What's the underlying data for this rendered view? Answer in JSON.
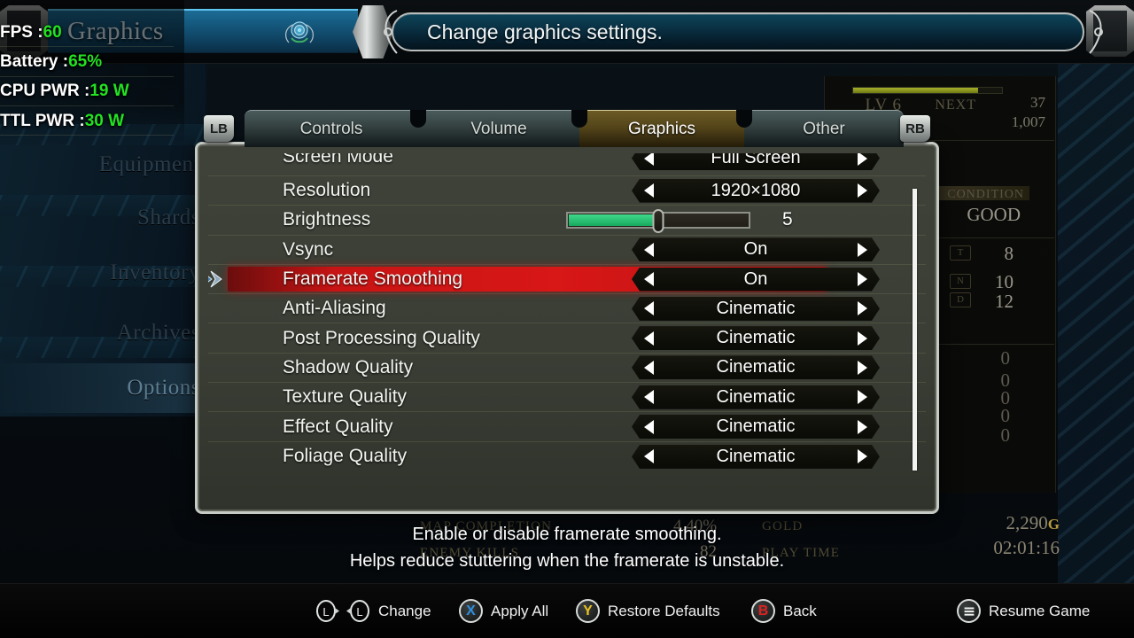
{
  "perf_overlay": {
    "rows": [
      {
        "label": "FPS :",
        "value": "60"
      },
      {
        "label": "Battery :",
        "value": "65%"
      },
      {
        "label": "CPU PWR :",
        "value": "19 W"
      },
      {
        "label": "TTL PWR :",
        "value": "30 W"
      }
    ],
    "value_color": "#22e222"
  },
  "header": {
    "title": "Graphics",
    "tooltip": "Change graphics settings."
  },
  "tabs": {
    "shoulder_left": "LB",
    "shoulder_right": "RB",
    "items": [
      {
        "label": "Controls",
        "active": false
      },
      {
        "label": "Volume",
        "active": false
      },
      {
        "label": "Graphics",
        "active": true
      },
      {
        "label": "Other",
        "active": false
      }
    ]
  },
  "settings": [
    {
      "name": "Screen Mode",
      "value": "Full Screen",
      "type": "stepper",
      "clipped": true,
      "selected": false
    },
    {
      "name": "Resolution",
      "value": "1920×1080",
      "type": "stepper",
      "selected": false
    },
    {
      "name": "Brightness",
      "value": "5",
      "type": "slider",
      "fill_percent": 50,
      "selected": false
    },
    {
      "name": "Vsync",
      "value": "On",
      "type": "stepper",
      "selected": false
    },
    {
      "name": "Framerate Smoothing",
      "value": "On",
      "type": "stepper",
      "selected": true
    },
    {
      "name": "Anti-Aliasing",
      "value": "Cinematic",
      "type": "stepper",
      "selected": false
    },
    {
      "name": "Post Processing Quality",
      "value": "Cinematic",
      "type": "stepper",
      "selected": false
    },
    {
      "name": "Shadow Quality",
      "value": "Cinematic",
      "type": "stepper",
      "selected": false
    },
    {
      "name": "Texture Quality",
      "value": "Cinematic",
      "type": "stepper",
      "selected": false
    },
    {
      "name": "Effect Quality",
      "value": "Cinematic",
      "type": "stepper",
      "selected": false
    },
    {
      "name": "Foliage Quality",
      "value": "Cinematic",
      "type": "stepper",
      "selected": false
    }
  ],
  "help": {
    "line1": "Enable or disable framerate smoothing.",
    "line2": "Helps reduce stuttering when the framerate is unstable."
  },
  "bottom_bar": [
    {
      "icon": "stick-pair-icon",
      "glyph": "",
      "label": "Change",
      "color": "#ffffff"
    },
    {
      "icon": "x-button-icon",
      "glyph": "X",
      "label": "Apply All",
      "color": "#2f8fe0"
    },
    {
      "icon": "y-button-icon",
      "glyph": "Y",
      "label": "Restore Defaults",
      "color": "#e8c022"
    },
    {
      "icon": "b-button-icon",
      "glyph": "B",
      "label": "Back",
      "color": "#e02020"
    },
    {
      "icon": "menu-button-icon",
      "glyph": "",
      "label": "Resume Game",
      "color": "#ffffff"
    }
  ],
  "background": {
    "menu_items": [
      {
        "label": "Equipment",
        "highlighted": false
      },
      {
        "label": "Shards",
        "highlighted": false
      },
      {
        "label": "Inventory",
        "highlighted": false
      },
      {
        "label": "Archives",
        "highlighted": false
      },
      {
        "label": "Options",
        "highlighted": true
      }
    ],
    "level_label": "LV 6",
    "next_label": "NEXT",
    "next_value": "37",
    "exp_value": "1,007",
    "condition_label": "CONDITION",
    "condition_value": "GOOD",
    "stat_values": [
      "8",
      "10",
      "12"
    ],
    "stat_tags": [
      "T",
      "N",
      "D"
    ],
    "zero_values": [
      "0",
      "0",
      "0",
      "0",
      "0"
    ],
    "map_completion_label": "MAP COMPLETION",
    "map_completion_value": "4.40%",
    "gold_label": "GOLD",
    "gold_value": "2,290",
    "gold_unit": "G",
    "enemy_kills_label": "ENEMY KILLS",
    "enemy_kills_value": "82",
    "play_time_label": "PLAY TIME",
    "play_time_value": "02:01:16"
  }
}
